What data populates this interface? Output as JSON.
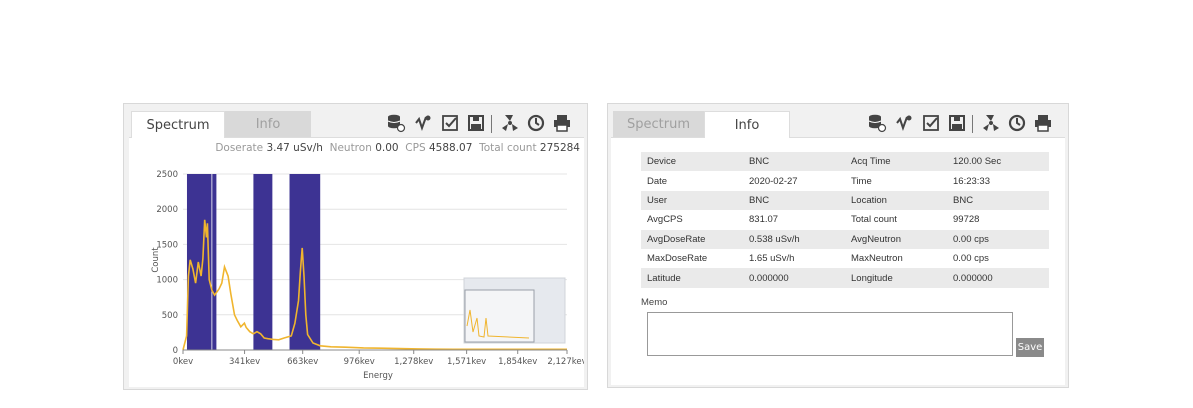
{
  "left_panel": {
    "tabs": [
      {
        "label": "Spectrum",
        "active": true
      },
      {
        "label": "Info",
        "active": false
      }
    ],
    "toolbar_icons": [
      "database-export-icon",
      "peak-search-icon",
      "checklist-edit-icon",
      "save-disk-icon",
      "fan-radiation-icon",
      "timer-reset-icon",
      "printer-icon"
    ],
    "stats": {
      "doserate_label": "Doserate",
      "doserate_value": "3.47 uSv/h",
      "neutron_label": "Neutron",
      "neutron_value": "0.00",
      "cps_label": "CPS",
      "cps_value": "4588.07",
      "total_label": "Total count",
      "total_value": "275284"
    }
  },
  "chart_data": {
    "type": "line",
    "xlabel": "Energy",
    "ylabel": "Count",
    "xlim": [
      0,
      2127
    ],
    "ylim": [
      0,
      2500
    ],
    "y_ticks": [
      "0",
      "500",
      "1000",
      "1500",
      "2000",
      "2500"
    ],
    "x_ticks": [
      "0kev",
      "341kev",
      "663kev",
      "976kev",
      "1,278kev",
      "1,571kev",
      "1,854kev",
      "2,127kev"
    ],
    "x_tick_values": [
      0,
      341,
      663,
      976,
      1278,
      1571,
      1854,
      2127
    ],
    "grid": true,
    "line_color": "#f0b52e",
    "roi_color": "#3d3393",
    "roi_bands": [
      [
        22,
        185
      ],
      [
        390,
        495
      ],
      [
        590,
        760
      ]
    ],
    "roi_markers": [
      160
    ],
    "series": [
      {
        "points": [
          [
            0,
            0
          ],
          [
            20,
            200
          ],
          [
            30,
            1050
          ],
          [
            40,
            1280
          ],
          [
            55,
            1150
          ],
          [
            70,
            950
          ],
          [
            85,
            1250
          ],
          [
            100,
            1050
          ],
          [
            110,
            1300
          ],
          [
            120,
            1850
          ],
          [
            130,
            1600
          ],
          [
            135,
            1800
          ],
          [
            145,
            1000
          ],
          [
            160,
            850
          ],
          [
            175,
            780
          ],
          [
            200,
            870
          ],
          [
            215,
            950
          ],
          [
            230,
            1180
          ],
          [
            250,
            1050
          ],
          [
            265,
            800
          ],
          [
            285,
            500
          ],
          [
            300,
            420
          ],
          [
            320,
            330
          ],
          [
            340,
            380
          ],
          [
            350,
            320
          ],
          [
            370,
            260
          ],
          [
            390,
            230
          ],
          [
            410,
            260
          ],
          [
            430,
            230
          ],
          [
            450,
            170
          ],
          [
            470,
            160
          ],
          [
            500,
            150
          ],
          [
            530,
            145
          ],
          [
            560,
            170
          ],
          [
            600,
            200
          ],
          [
            620,
            380
          ],
          [
            640,
            700
          ],
          [
            650,
            1100
          ],
          [
            660,
            1450
          ],
          [
            670,
            1050
          ],
          [
            680,
            500
          ],
          [
            690,
            220
          ],
          [
            720,
            100
          ],
          [
            760,
            60
          ],
          [
            820,
            45
          ],
          [
            900,
            40
          ],
          [
            1000,
            30
          ],
          [
            1100,
            25
          ],
          [
            1200,
            20
          ],
          [
            1300,
            15
          ],
          [
            1400,
            12
          ],
          [
            1500,
            10
          ],
          [
            1600,
            10
          ],
          [
            1700,
            10
          ],
          [
            1800,
            10
          ],
          [
            1900,
            10
          ],
          [
            2000,
            10
          ],
          [
            2127,
            10
          ]
        ]
      }
    ]
  },
  "right_panel": {
    "tabs": [
      {
        "label": "Spectrum",
        "active": false
      },
      {
        "label": "Info",
        "active": true
      }
    ],
    "toolbar_icons": [
      "database-export-icon",
      "peak-search-icon",
      "checklist-edit-icon",
      "save-disk-icon",
      "fan-radiation-icon",
      "timer-reset-icon",
      "printer-icon"
    ],
    "rows": [
      [
        "Device",
        "BNC",
        "Acq Time",
        "120.00 Sec"
      ],
      [
        "Date",
        "2020-02-27",
        "Time",
        "16:23:33"
      ],
      [
        "User",
        "BNC",
        "Location",
        "BNC"
      ],
      [
        "AvgCPS",
        "831.07",
        "Total count",
        "99728"
      ],
      [
        "AvgDoseRate",
        "0.538 uSv/h",
        "AvgNeutron",
        "0.00 cps"
      ],
      [
        "MaxDoseRate",
        "1.65 uSv/h",
        "MaxNeutron",
        "0.00 cps"
      ],
      [
        "Latitude",
        "0.000000",
        "Longitude",
        "0.000000"
      ]
    ],
    "memo_label": "Memo",
    "memo_value": "",
    "save_label": "Save"
  }
}
